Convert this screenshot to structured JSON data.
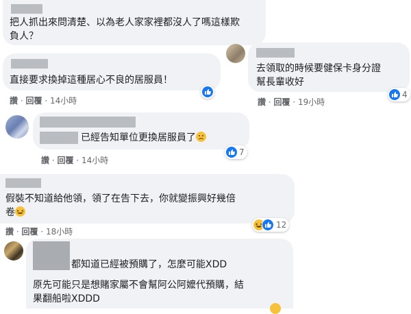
{
  "comments": [
    {
      "text_line1": "把人抓出來問清楚、以為老人家家裡都沒人了嗎這樣欺",
      "text_line2": "負人？"
    },
    {
      "text": "直接要求換掉這種居心不良的居服員！",
      "time": "14小時"
    },
    {
      "text_line1": "去領取的時候要健保卡身分證",
      "text_line2": "幫長輩收好",
      "time": "19小時",
      "reactions": "4"
    },
    {
      "text": "已經告知單位更換居服員了",
      "time": "14小時",
      "reactions": "7"
    },
    {
      "text_line1": "假裝不知道給他領，領了在告下去，你就變振興好幾倍",
      "text_line2": "卷",
      "time": "18小時",
      "reactions": "12"
    },
    {
      "text_line1": "都知道已經被預購了，怎麼可能XDD",
      "text_line2": "原先可能只是想賭家屬不會幫阿公阿嬤代預購，結",
      "text_line3": "果翻船啦XDDD"
    }
  ],
  "action_labels": {
    "like": "讚",
    "reply": "回覆",
    "sep": "·"
  },
  "icons": [
    "like-icon",
    "haha-icon",
    "sad-emoji-icon",
    "laugh-emoji-icon"
  ],
  "colors": {
    "bubble": "#f0f2f5",
    "redaction": "#b9bcc1",
    "like_blue": "#1877f2",
    "emoji_yellow": "#f7c23b",
    "meta": "#65676b"
  }
}
